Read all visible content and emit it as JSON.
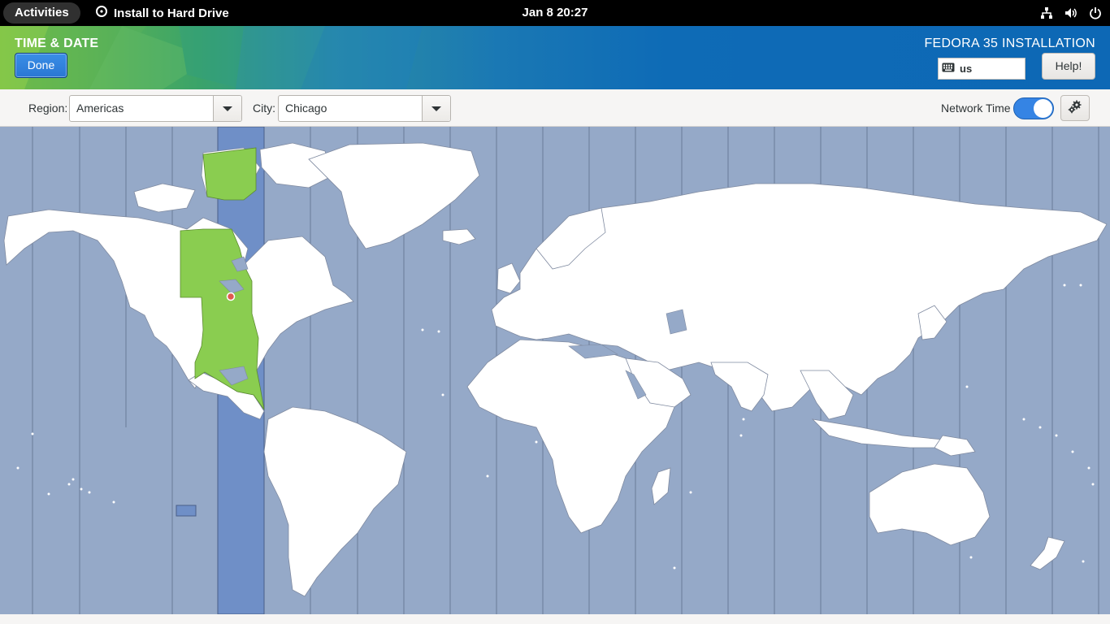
{
  "topbar": {
    "activities_label": "Activities",
    "app_name": "Install to Hard Drive",
    "clock": "Jan 8  20:27",
    "icons": [
      "network-wired-icon",
      "volume-icon",
      "power-icon"
    ]
  },
  "header": {
    "page_title": "TIME & DATE",
    "done_label": "Done",
    "product_title": "FEDORA 35 INSTALLATION",
    "keyboard_layout": "us",
    "help_label": "Help!"
  },
  "toolbar": {
    "region_label": "Region:",
    "region_value": "Americas",
    "city_label": "City:",
    "city_value": "Chicago",
    "network_time_label": "Network Time",
    "network_time_enabled": true
  },
  "map": {
    "selected_timezone": "America/Chicago",
    "colors": {
      "ocean": "#95a9c8",
      "land": "#ffffff",
      "selected_zone_land": "#8acd50",
      "selected_zone_ocean": "#6f8fc7",
      "pin": "#e05a4e"
    }
  }
}
